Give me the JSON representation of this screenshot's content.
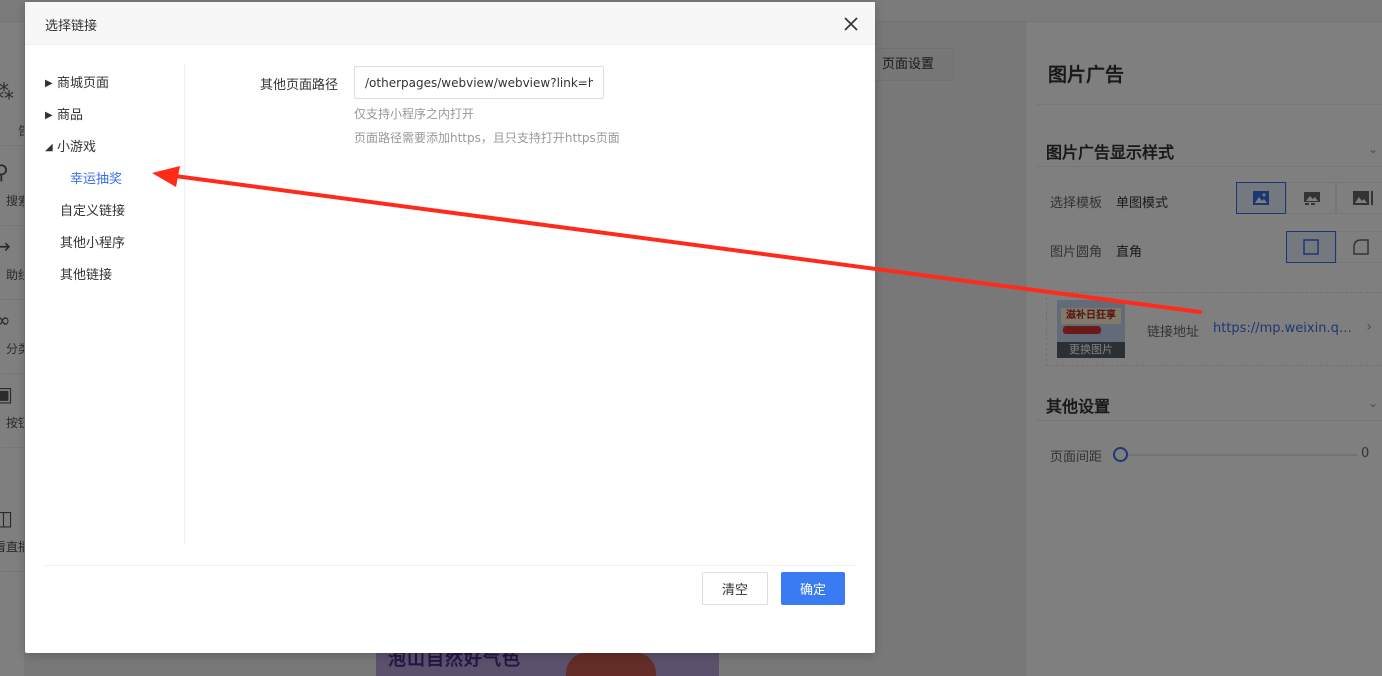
{
  "background": {
    "left_nav": [
      {
        "label": "告",
        "icon": "ad-icon"
      },
      {
        "label": "搜索",
        "icon": "search-icon"
      },
      {
        "label": "助线",
        "icon": "line-icon"
      },
      {
        "label": "分类",
        "icon": "category-icon"
      },
      {
        "label": "按钮",
        "icon": "button-icon"
      },
      {
        "label": "",
        "icon": ""
      },
      {
        "label": "看直播",
        "icon": "live-icon"
      }
    ],
    "page_settings_label": "页面设置",
    "banner_text": "泡山自然好气色"
  },
  "right_panel": {
    "title": "图片广告",
    "display_section_title": "图片广告显示样式",
    "template_label": "选择模板",
    "template_value": "单图模式",
    "corner_label": "图片圆角",
    "corner_value": "直角",
    "ad_thumb_text": "滋补日狂享",
    "change_image_label": "更换图片",
    "link_label": "链接地址",
    "link_value": "https://mp.weixin.qq.com/",
    "other_section_title": "其他设置",
    "spacing_label": "页面间距",
    "spacing_value": "0"
  },
  "modal": {
    "title": "选择链接",
    "tree": [
      {
        "label": "商城页面",
        "expander": "▶"
      },
      {
        "label": "商品",
        "expander": "▶"
      },
      {
        "label": "小游戏",
        "expander": "◢"
      },
      {
        "label": "幸运抽奖",
        "expander": ""
      },
      {
        "label": "自定义链接",
        "expander": ""
      },
      {
        "label": "其他小程序",
        "expander": ""
      },
      {
        "label": "其他链接",
        "expander": ""
      }
    ],
    "path_label": "其他页面路径",
    "path_value": "/otherpages/webview/webview?link=https://mp.weixin.qq.com/",
    "help_line_1": "仅支持小程序之内打开",
    "help_line_2": "页面路径需要添加https，且只支持打开https页面",
    "clear_label": "清空",
    "confirm_label": "确定"
  },
  "colors": {
    "accent": "#3a7bf2",
    "annotation_arrow": "#ff2a1a"
  }
}
